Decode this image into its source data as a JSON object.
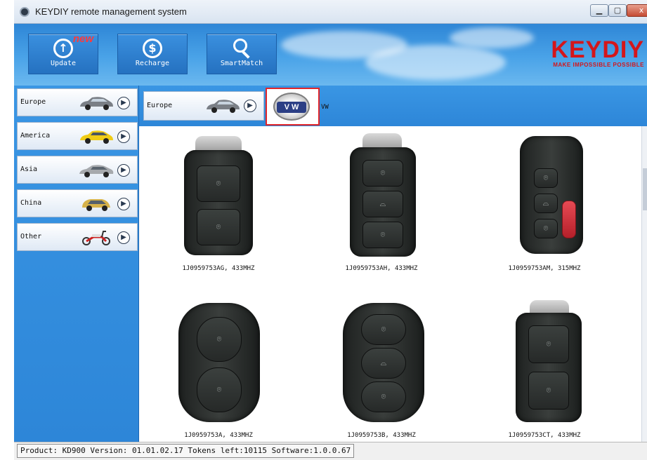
{
  "window": {
    "title": "KEYDIY remote management system",
    "controls": {
      "minimize": "▁",
      "maximize": "▢",
      "close": "x"
    }
  },
  "toolbar": {
    "update_label": "Update",
    "update_badge": "new",
    "recharge_label": "Recharge",
    "smartmatch_label": "SmartMatch"
  },
  "brand": {
    "logo": "KEYDIY",
    "slogan": "MAKE IMPOSSIBLE POSSIBLE"
  },
  "sidebar": {
    "items": [
      {
        "label": "Europe",
        "icon": "car-icon"
      },
      {
        "label": "America",
        "icon": "car-icon"
      },
      {
        "label": "Asia",
        "icon": "car-icon"
      },
      {
        "label": "China",
        "icon": "car-icon"
      },
      {
        "label": "Other",
        "icon": "scooter-icon"
      }
    ]
  },
  "breadcrumb": {
    "region": "Europe",
    "brand_label": "VW",
    "brand_logo_text": "V W"
  },
  "remotes": [
    {
      "model": "1J0959753AG, 433MHZ"
    },
    {
      "model": "1J0959753AH, 433MHZ"
    },
    {
      "model": "1J0959753AM, 315MHZ"
    },
    {
      "model": "1J0959753A, 433MHZ"
    },
    {
      "model": "1J0959753B, 433MHZ"
    },
    {
      "model": "1J0959753CT, 433MHZ"
    }
  ],
  "status": {
    "text": "Product: KD900  Version: 01.01.02.17  Tokens left:10115  Software:1.0.0.67"
  },
  "colors": {
    "accent_blue": "#2d86d8",
    "brand_red": "#d4161b",
    "selection_border": "#e0262b"
  }
}
